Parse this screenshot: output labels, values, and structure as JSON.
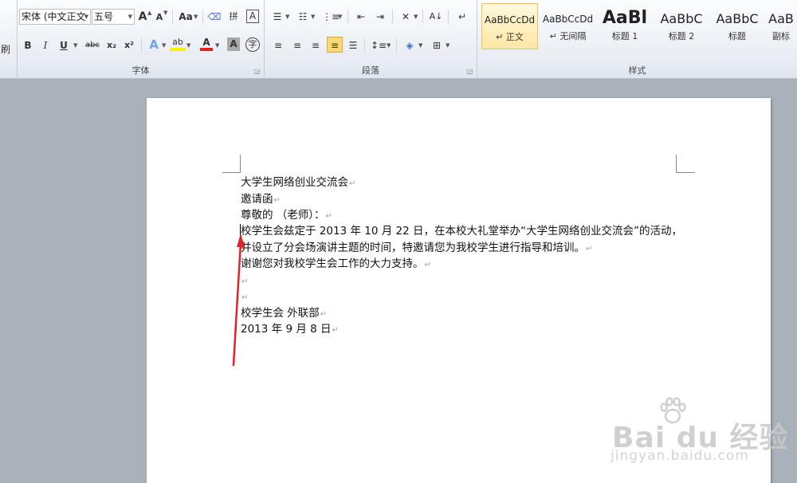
{
  "ribbon": {
    "clipboard_partial_label": "刷",
    "font_group": {
      "label": "字体",
      "font_name": "宋体 (中文正文",
      "font_size": "五号",
      "grow_font": "A",
      "shrink_font": "A",
      "change_case": "Aa",
      "pinyin_guide": "拼",
      "char_border": "A",
      "bold": "B",
      "italic": "I",
      "underline": "U",
      "strikethrough": "abc",
      "subscript": "x₂",
      "superscript": "x²",
      "text_effect": "A",
      "highlight": "ab",
      "font_color": "A",
      "char_shading": "A",
      "enclose_char": "字"
    },
    "paragraph_group": {
      "label": "段落"
    },
    "styles_group": {
      "label": "样式",
      "items": [
        {
          "preview": "AaBbCcDd",
          "name": "↵ 正文"
        },
        {
          "preview": "AaBbCcDd",
          "name": "↵ 无间隔"
        },
        {
          "preview": "AaBl",
          "name": "标题 1"
        },
        {
          "preview": "AaBbC",
          "name": "标题 2"
        },
        {
          "preview": "AaBbC",
          "name": "标题"
        },
        {
          "preview": "AaB",
          "name": "副标"
        }
      ]
    }
  },
  "document": {
    "lines": [
      "大学生网络创业交流会",
      "邀请函",
      "尊敬的          （老师）：",
      "校学生会兹定于 2013 年 10 月 22 日，在本校大礼堂举办“大学生网络创业交流会”的活动，",
      "并设立了分会场演讲主题的时间，特邀请您为我校学生进行指导和培训。",
      "谢谢您对我校学生会工作的大力支持。",
      "",
      "",
      "校学生会 外联部",
      "2013 年 9 月 8 日"
    ],
    "paragraph_mark": "↵"
  },
  "watermark": {
    "brand": "Bai du 经验",
    "url": "jingyan.baidu.com"
  },
  "colors": {
    "arrow": "#e0232a",
    "ribbon_bg": "#e6ebf2",
    "workspace_bg": "#a9b1bb",
    "selected_style": "#fde7a5"
  }
}
